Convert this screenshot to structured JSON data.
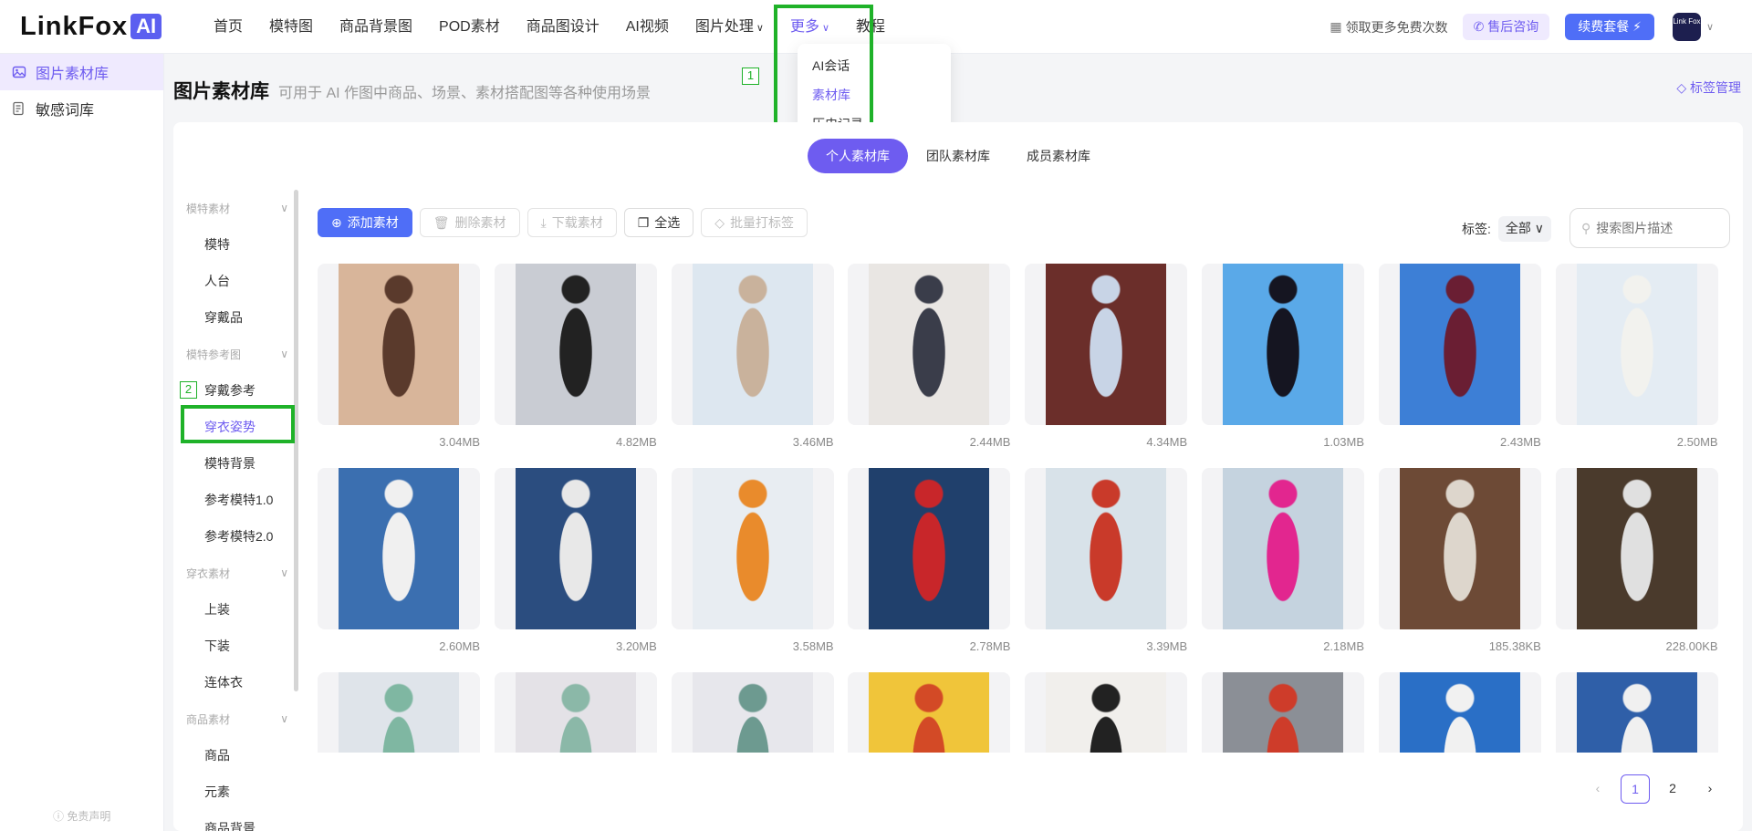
{
  "app": {
    "logo_text": "LinkFox",
    "logo_badge": "AI"
  },
  "nav": {
    "items": [
      "首页",
      "模特图",
      "商品背景图",
      "POD素材",
      "商品图设计",
      "AI视频",
      "图片处理",
      "更多",
      "教程"
    ],
    "dropdown": [
      "AI会话",
      "素材库",
      "历史记录"
    ]
  },
  "header": {
    "free": "领取更多免费次数",
    "consult": "售后咨询",
    "renew": "续费套餐",
    "avatar_text": "Link Fox"
  },
  "annotations": {
    "box1": "1",
    "box2": "2"
  },
  "sidebar": {
    "items": [
      "图片素材库",
      "敏感词库"
    ],
    "disclaimer": "免责声明"
  },
  "page": {
    "title": "图片素材库",
    "subtitle": "可用于 AI 作图中商品、场景、素材搭配图等各种使用场景",
    "tag_mgmt": "标签管理"
  },
  "lib_tabs": [
    "个人素材库",
    "团队素材库",
    "成员素材库"
  ],
  "categories": {
    "groups": [
      {
        "label": "模特素材",
        "items": [
          "模特",
          "人台",
          "穿戴品"
        ]
      },
      {
        "label": "模特参考图",
        "items": [
          "穿戴参考",
          "穿衣姿势",
          "模特背景",
          "参考模特1.0",
          "参考模特2.0"
        ]
      },
      {
        "label": "穿衣素材",
        "items": [
          "上装",
          "下装",
          "连体衣"
        ]
      },
      {
        "label": "商品素材",
        "items": [
          "商品",
          "元素",
          "商品背景"
        ]
      }
    ]
  },
  "toolbar": {
    "add": "添加素材",
    "delete": "删除素材",
    "download": "下载素材",
    "select_all": "全选",
    "batch_tag": "批量打标签"
  },
  "filter": {
    "label": "标签:",
    "value": "全部",
    "search_placeholder": "搜索图片描述"
  },
  "images": {
    "row1": [
      "3.04MB",
      "4.82MB",
      "3.46MB",
      "2.44MB",
      "4.34MB",
      "1.03MB",
      "2.43MB",
      "2.50MB"
    ],
    "row2": [
      "2.60MB",
      "3.20MB",
      "3.58MB",
      "2.78MB",
      "3.39MB",
      "2.18MB",
      "185.38KB",
      "228.00KB"
    ],
    "row3": [
      "",
      "",
      "",
      "",
      "",
      "",
      "",
      ""
    ]
  },
  "pagination": {
    "prev": "‹",
    "pages": [
      "1",
      "2"
    ],
    "next": "›",
    "current": "1"
  },
  "colors": {
    "accent": "#6e5cf0",
    "primary": "#4f6ef7",
    "annotation": "#1fb229"
  }
}
